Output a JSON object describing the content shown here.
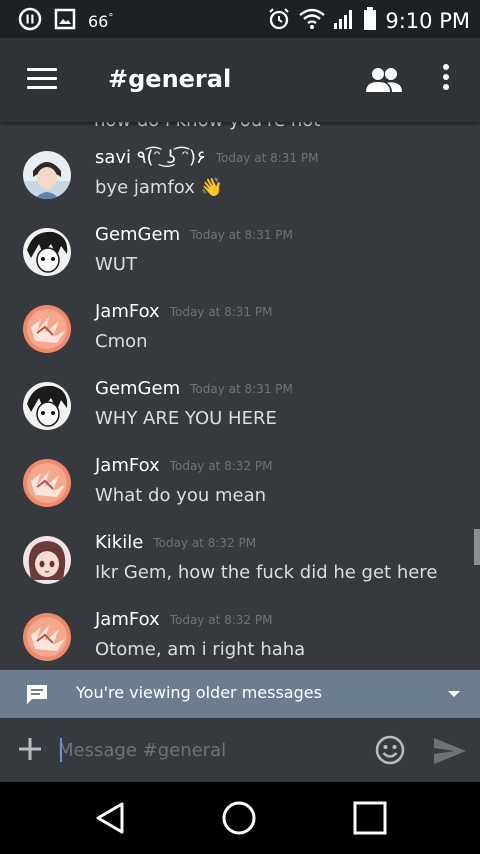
{
  "status_bar": {
    "battery_level": "66",
    "degree_sign": "°",
    "time": "9:10 PM",
    "icons": [
      "recording-icon",
      "image-icon",
      "alarm-icon",
      "wifi-icon",
      "signal-icon",
      "battery-icon"
    ]
  },
  "app_bar": {
    "channel_name": "#general",
    "icons": [
      "menu-icon",
      "members-icon",
      "more-icon"
    ]
  },
  "messages": {
    "partial_previous": "how do i know you're not",
    "items": [
      {
        "author": "savi ٩(͡ᵔ ͜ʖ ͡ᵔ)۶",
        "time": "Today at 8:31 PM",
        "text": "bye jamfox",
        "emoji": "👋",
        "avatar": "savi-avatar"
      },
      {
        "author": "GemGem",
        "time": "Today at 8:31 PM",
        "text": "WUT",
        "avatar": "gemgem-avatar"
      },
      {
        "author": "JamFox",
        "time": "Today at 8:31 PM",
        "text": "Cmon",
        "avatar": "jamfox-avatar"
      },
      {
        "author": "GemGem",
        "time": "Today at 8:31 PM",
        "text": "WHY ARE YOU HERE",
        "avatar": "gemgem-avatar"
      },
      {
        "author": "JamFox",
        "time": "Today at 8:32 PM",
        "text": "What do you mean",
        "avatar": "jamfox-avatar"
      },
      {
        "author": "Kikile",
        "time": "Today at 8:32 PM",
        "text": "Ikr Gem, how the fuck did he get here",
        "avatar": "kikile-avatar"
      },
      {
        "author": "JamFox",
        "time": "Today at 8:32 PM",
        "text": "Otome, am i right haha",
        "avatar": "jamfox-avatar"
      }
    ]
  },
  "older_banner": {
    "label": "You're viewing older messages"
  },
  "composer": {
    "placeholder": "Message #general"
  },
  "colors": {
    "background": "#36393e",
    "app_bar": "#2f3237",
    "banner": "#6b7d8f",
    "accent": "#7289da",
    "timestamp": "#6f7277"
  }
}
